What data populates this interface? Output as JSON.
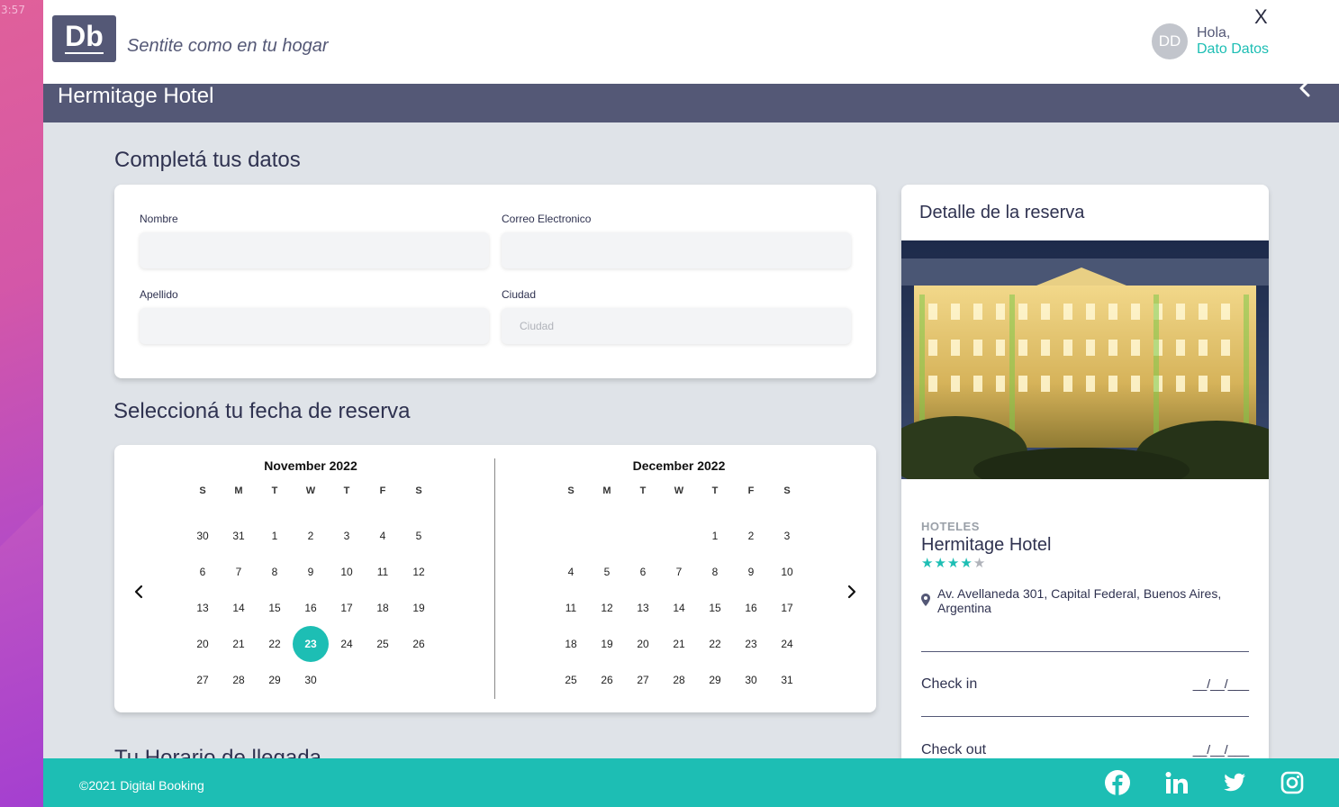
{
  "desktop": {
    "time": "3:57"
  },
  "header": {
    "logo": "Db",
    "slogan": "Sentite como en tu hogar",
    "avatar_initials": "DD",
    "greeting": "Hola,",
    "user_name": "Dato Datos",
    "close": "X"
  },
  "titlebar": {
    "title": "Hermitage Hotel"
  },
  "form": {
    "section_title": "Completá tus datos",
    "fields": {
      "nombre": {
        "label": "Nombre",
        "value": "",
        "placeholder": ""
      },
      "correo": {
        "label": "Correo Electronico",
        "value": "",
        "placeholder": ""
      },
      "apellido": {
        "label": "Apellido",
        "value": "",
        "placeholder": ""
      },
      "ciudad": {
        "label": "Ciudad",
        "value": "",
        "placeholder": "Ciudad"
      }
    }
  },
  "calendar": {
    "section_title": "Seleccioná tu fecha de reserva",
    "weekdays": [
      "S",
      "M",
      "T",
      "W",
      "T",
      "F",
      "S"
    ],
    "months": [
      {
        "title": "November 2022",
        "weeks": [
          [
            "30",
            "31",
            "1",
            "2",
            "3",
            "4",
            "5"
          ],
          [
            "6",
            "7",
            "8",
            "9",
            "10",
            "11",
            "12"
          ],
          [
            "13",
            "14",
            "15",
            "16",
            "17",
            "18",
            "19"
          ],
          [
            "20",
            "21",
            "22",
            "23",
            "24",
            "25",
            "26"
          ],
          [
            "27",
            "28",
            "29",
            "30",
            "",
            "",
            ""
          ]
        ],
        "selected": "23"
      },
      {
        "title": "December 2022",
        "weeks": [
          [
            "",
            "",
            "",
            "",
            "1",
            "2",
            "3"
          ],
          [
            "4",
            "5",
            "6",
            "7",
            "8",
            "9",
            "10"
          ],
          [
            "11",
            "12",
            "13",
            "14",
            "15",
            "16",
            "17"
          ],
          [
            "18",
            "19",
            "20",
            "21",
            "22",
            "23",
            "24"
          ],
          [
            "25",
            "26",
            "27",
            "28",
            "29",
            "30",
            "31"
          ]
        ],
        "selected": ""
      }
    ]
  },
  "arrival": {
    "section_title": "Tu Horario de llegada"
  },
  "detail": {
    "title": "Detalle de la reserva",
    "category": "HOTELES",
    "hotel_name": "Hermitage Hotel",
    "stars": 4,
    "max_stars": 5,
    "address": "Av. Avellaneda 301, Capital Federal, Buenos Aires, Argentina",
    "check_in_label": "Check in",
    "check_in_value": "__/__/___",
    "check_out_label": "Check out",
    "check_out_value": "__/__/___"
  },
  "footer": {
    "copyright": "©2021 Digital Booking",
    "social": [
      "facebook-icon",
      "linkedin-icon",
      "twitter-icon",
      "instagram-icon"
    ]
  },
  "colors": {
    "primary": "#545876",
    "accent": "#1dbeb4",
    "background": "#dfe3e8"
  }
}
